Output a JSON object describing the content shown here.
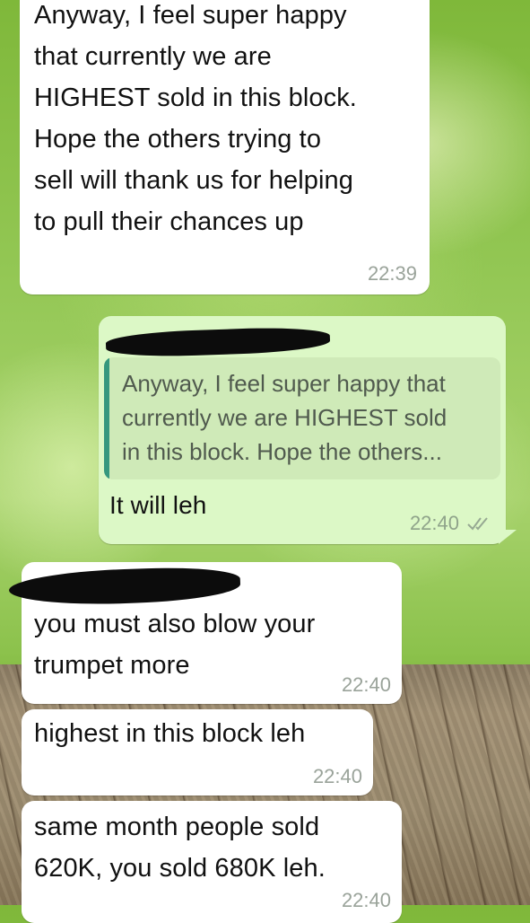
{
  "messages": [
    {
      "direction": "incoming",
      "text": "Anyway, I feel super happy that currently we are HIGHEST sold in this block. Hope the others trying to sell will thank us for helping to pull their chances up",
      "lines": [
        "Anyway, I feel super happy",
        "that currently we are",
        "HIGHEST sold in this block.",
        "Hope the others trying to",
        "sell will thank us for helping",
        "to pull their chances up"
      ],
      "time": "22:39"
    },
    {
      "direction": "outgoing",
      "quote": {
        "lines": [
          "Anyway, I feel super happy that",
          "currently we are HIGHEST sold",
          "in this block. Hope the others..."
        ]
      },
      "text": "It will leh",
      "time": "22:40",
      "status_icon": "double-check-icon"
    },
    {
      "direction": "incoming",
      "lines": [
        "you must also blow your",
        "trumpet more"
      ],
      "time": "22:40"
    },
    {
      "direction": "incoming",
      "lines": [
        "highest in this block leh"
      ],
      "time": "22:40"
    },
    {
      "direction": "incoming",
      "lines": [
        "same month people sold",
        "620K, you sold 680K leh."
      ],
      "time": "22:40"
    }
  ],
  "colors": {
    "incoming_bubble": "#ffffff",
    "outgoing_bubble": "#dcf8c6",
    "quote_bar": "#35987e",
    "timestamp": "#9aa39a"
  }
}
